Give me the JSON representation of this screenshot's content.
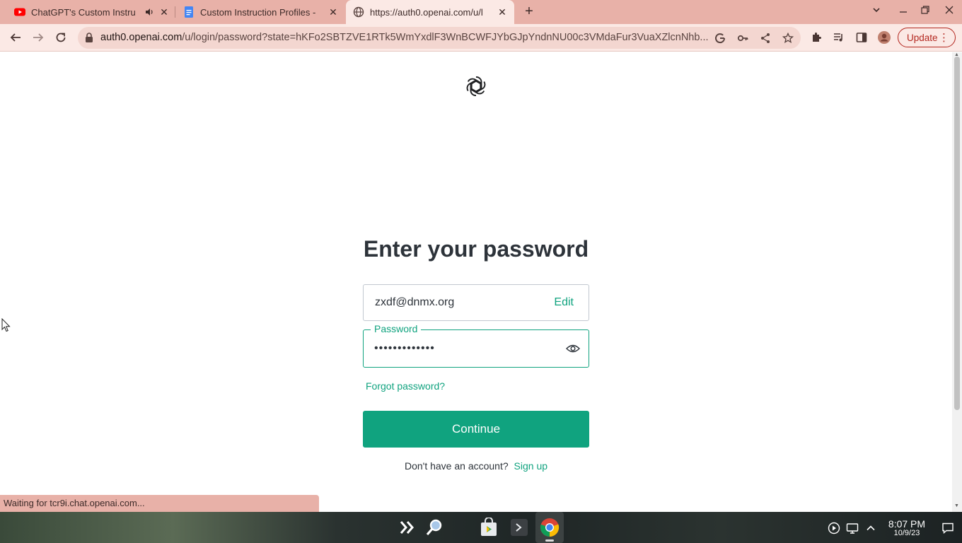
{
  "browser": {
    "tabs": [
      {
        "title": "ChatGPT's Custom Instru",
        "favicon": "youtube-icon",
        "audio": true,
        "active": false
      },
      {
        "title": "Custom Instruction Profiles -",
        "favicon": "google-docs-icon",
        "active": false
      },
      {
        "title": "https://auth0.openai.com/u/l",
        "favicon": "globe-icon",
        "active": true
      }
    ],
    "address_bar": {
      "domain": "auth0.openai.com",
      "path": "/u/login/password?state=hKFo2SBTZVE1RTk5WmYxdlF3WnBCWFJYbGJpYndnNU00c3VMdaFur3VuaXZlcnNhb..."
    },
    "update_label": "Update",
    "status_text": "Waiting for tcr9i.chat.openai.com..."
  },
  "login": {
    "heading": "Enter your password",
    "email": "zxdf@dnmx.org",
    "edit_label": "Edit",
    "password_label": "Password",
    "password_mask": "•••••••••••••",
    "forgot_label": "Forgot password?",
    "continue_label": "Continue",
    "no_account_text": "Don't have an account?",
    "signup_label": "Sign up"
  },
  "taskbar": {
    "time": "8:07 PM",
    "date": "10/9/23"
  },
  "colors": {
    "accent": "#10a37f",
    "tab_strip": "#e8b1a8",
    "toolbar": "#fbe9e5"
  }
}
